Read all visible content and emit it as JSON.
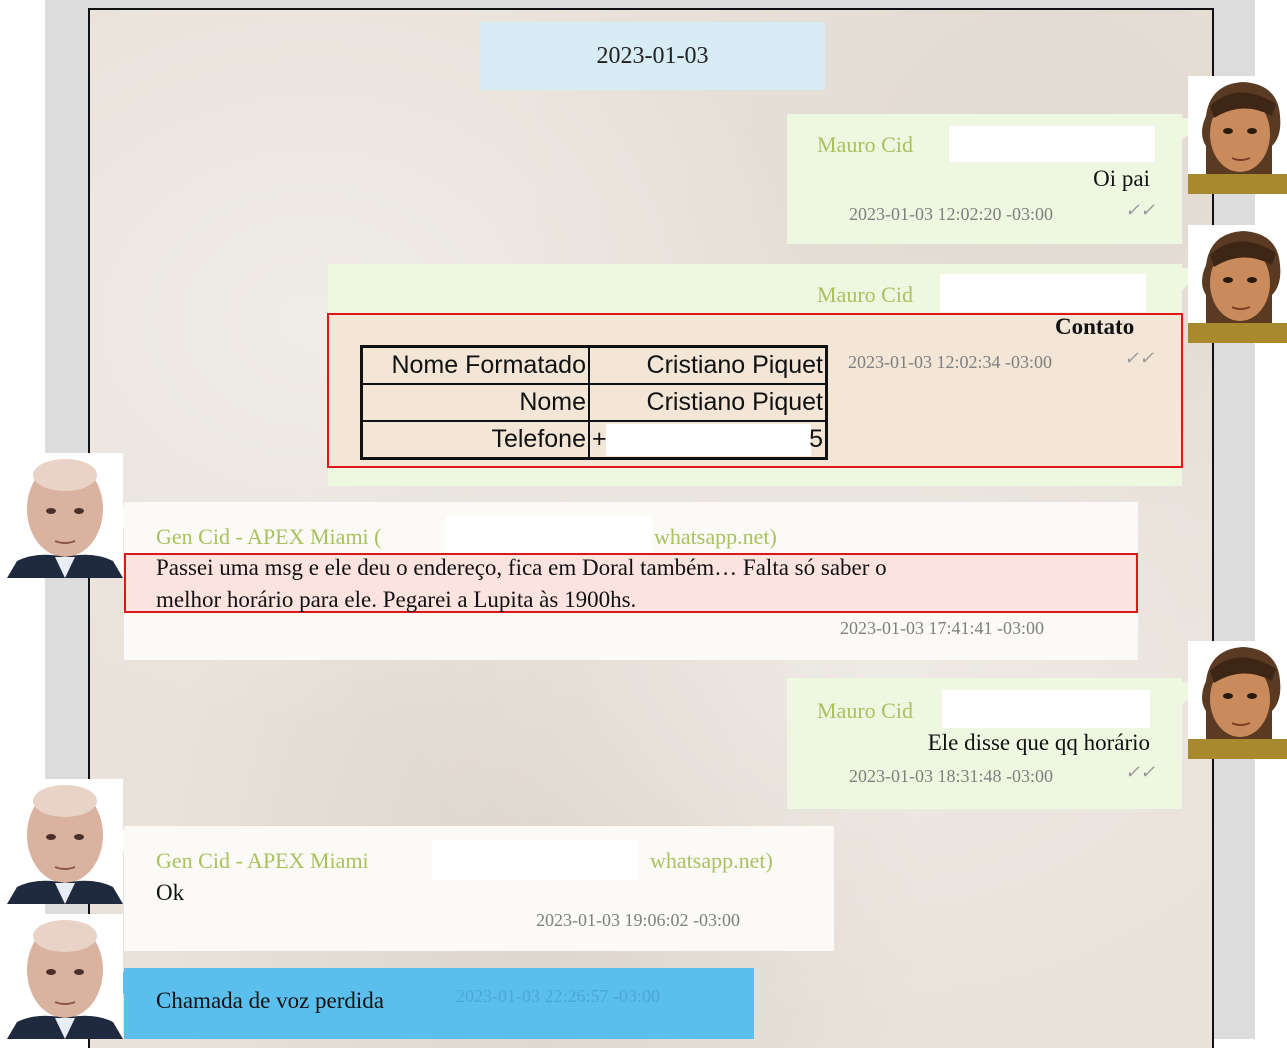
{
  "chat": {
    "date_separator": "2023-01-03",
    "messages": [
      {
        "sender": "Mauro Cid",
        "text": "Oi pai",
        "timestamp": "2023-01-03 12:02:20 -03:00",
        "ticks": "✓✓"
      },
      {
        "sender": "Mauro Cid",
        "type_label": "Contato",
        "timestamp": "2023-01-03 12:02:34 -03:00",
        "ticks": "✓✓",
        "contact": {
          "rows": [
            {
              "label": "Nome Formatado",
              "value": "Cristiano Piquet"
            },
            {
              "label": "Nome",
              "value": "Cristiano Piquet"
            },
            {
              "label": "Telefone",
              "value_prefix": "+",
              "value_suffix": "5"
            }
          ]
        }
      },
      {
        "sender": "Gen Cid - APEX Miami (",
        "sender_suffix": "whatsapp.net)",
        "text_line1": "Passei uma msg e ele deu o endereço, fica em Doral também… Falta só saber o",
        "text_line2": "melhor horário para ele. Pegarei a Lupita às 1900hs.",
        "timestamp": "2023-01-03 17:41:41 -03:00"
      },
      {
        "sender": "Mauro Cid",
        "text": "Ele disse que qq horário",
        "timestamp": "2023-01-03 18:31:48 -03:00",
        "ticks": "✓✓"
      },
      {
        "sender": "Gen Cid - APEX Miami",
        "sender_suffix": "whatsapp.net)",
        "text": "Ok",
        "timestamp": "2023-01-03 19:06:02 -03:00"
      },
      {
        "text": "Chamada de voz perdida",
        "timestamp": "2023-01-03 22:26:57 -03:00"
      }
    ]
  },
  "colors": {
    "sender_name": "#a9c15f",
    "outgoing_bubble": "#eef8e0",
    "incoming_bubble": "#fbfaf6",
    "date_chip": "#d7ecf5",
    "missed_call_bubble": "#5bbfee",
    "highlight_box": "#e0161b"
  },
  "icons": {
    "read_receipt": "double-check-icon",
    "avatar_mauro": "avatar-mauro-cid",
    "avatar_gen": "avatar-gen-cid"
  }
}
